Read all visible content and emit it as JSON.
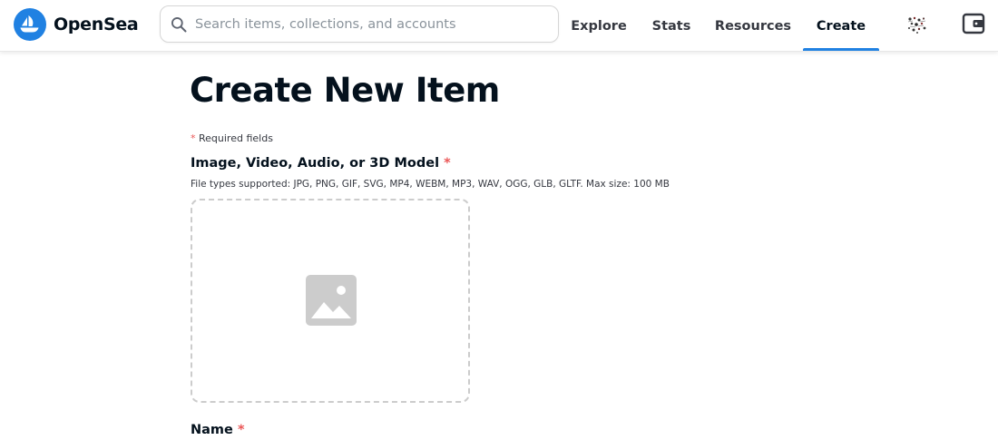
{
  "header": {
    "brand_name": "OpenSea",
    "search": {
      "placeholder": "Search items, collections, and accounts",
      "value": ""
    },
    "nav": {
      "explore": "Explore",
      "stats": "Stats",
      "resources": "Resources",
      "create": "Create"
    },
    "active_nav": "Create",
    "icons": {
      "logo": "opensea-logo-icon",
      "search": "search-icon",
      "avatar": "profile-avatar",
      "wallet": "wallet-icon"
    }
  },
  "form": {
    "title": "Create New Item",
    "required_note": {
      "asterisk": "*",
      "text": "Required fields"
    },
    "media": {
      "label": "Image, Video, Audio, or 3D Model",
      "required_mark": "*",
      "hint": "File types supported: JPG, PNG, GIF, SVG, MP4, WEBM, MP3, WAV, OGG, GLB, GLTF. Max size: 100 MB",
      "placeholder_icon": "image-icon"
    },
    "name": {
      "label": "Name",
      "required_mark": "*"
    }
  },
  "colors": {
    "brand_blue": "#2081e2",
    "required_red": "#eb5757",
    "text_dark": "#04111d",
    "dropzone_border": "#cccccc"
  }
}
